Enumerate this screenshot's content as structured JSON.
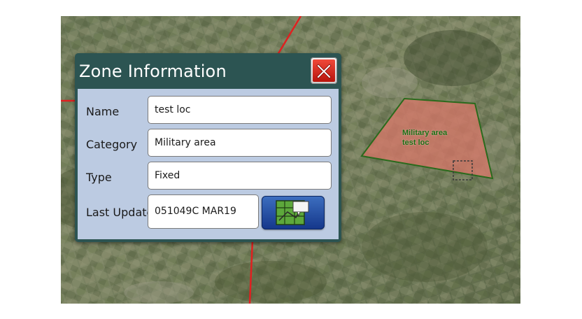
{
  "map": {
    "zone": {
      "category_label": "Military area",
      "name_label": "test loc",
      "fill_color": "#d9776a",
      "border_color": "#2a6a1c",
      "label_color": "#1b6e12"
    },
    "grid_line_color": "#e02020"
  },
  "dialog": {
    "title": "Zone Information",
    "close_icon": "close-icon",
    "fields": {
      "name": {
        "label": "Name",
        "value": "test loc"
      },
      "category": {
        "label": "Category",
        "value": "Military area"
      },
      "type": {
        "label": "Type",
        "value": "Fixed"
      },
      "last_update": {
        "label": "Last Update",
        "value": "051049C MAR19"
      }
    },
    "map_button_icon": "map-locate-icon"
  }
}
